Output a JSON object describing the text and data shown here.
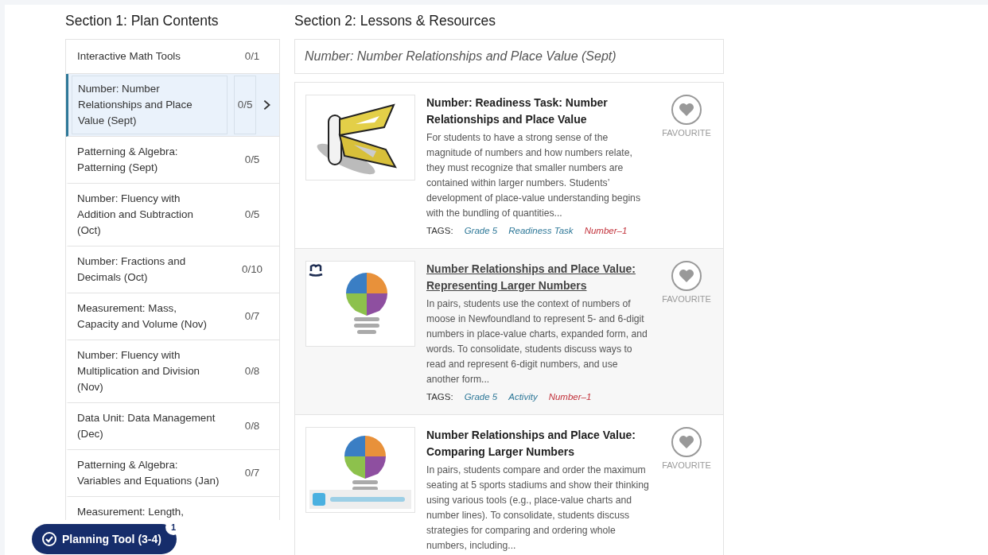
{
  "section1": {
    "title": "Section 1: Plan Contents",
    "items": [
      {
        "label": "Interactive Math Tools",
        "count": "0/1",
        "selected": false
      },
      {
        "label": "Number: Number Relationships and Place Value (Sept)",
        "count": "0/5",
        "selected": true
      },
      {
        "label": "Patterning & Algebra: Patterning (Sept)",
        "count": "0/5",
        "selected": false
      },
      {
        "label": "Number: Fluency with Addition and Subtraction (Oct)",
        "count": "0/5",
        "selected": false
      },
      {
        "label": "Number: Fractions and Decimals (Oct)",
        "count": "0/10",
        "selected": false
      },
      {
        "label": "Measurement: Mass, Capacity and Volume (Nov)",
        "count": "0/7",
        "selected": false
      },
      {
        "label": "Number: Fluency with Multiplication and Division (Nov)",
        "count": "0/8",
        "selected": false
      },
      {
        "label": "Data Unit: Data Management (Dec)",
        "count": "0/8",
        "selected": false
      },
      {
        "label": "Patterning & Algebra: Variables and Equations (Jan)",
        "count": "0/7",
        "selected": false
      },
      {
        "label": "Measurement: Length,",
        "selected": false
      }
    ]
  },
  "section2": {
    "title": "Section 2: Lessons & Resources",
    "unit_title": "Number: Number Relationships and Place Value (Sept)",
    "resources": [
      {
        "title": "Number: Readiness Task: Number Relationships and Place Value",
        "hovered": false,
        "description": "For students to have a strong sense of the magnitude of numbers and how numbers relate, they must recognize that smaller numbers are contained within larger numbers. Students’ development of place-value understanding begins with the bundling of quantities...",
        "tags_label": "TAGS:",
        "tags": [
          {
            "label": "Grade 5",
            "color": "#2e7898"
          },
          {
            "label": "Readiness Task",
            "color": "#2e7898"
          },
          {
            "label": "Number–1",
            "color": "#c2313a"
          }
        ],
        "favourite": "FAVOURITE"
      },
      {
        "title": "Number Relationships and Place Value: Representing Larger Numbers",
        "hovered": true,
        "description": "In pairs, students use the context of numbers of moose in Newfoundland to represent 5- and 6-digit numbers in place-value charts, expanded form, and words. To consolidate, students discuss ways to read and represent 6-digit numbers, and use another form...",
        "tags_label": "TAGS:",
        "tags": [
          {
            "label": "Grade 5",
            "color": "#2e7898"
          },
          {
            "label": "Activity",
            "color": "#2e7898"
          },
          {
            "label": "Number–1",
            "color": "#c2313a"
          }
        ],
        "favourite": "FAVOURITE"
      },
      {
        "title": "Number Relationships and Place Value: Comparing Larger Numbers",
        "hovered": false,
        "description": "In pairs, students compare and order the maximum seating at 5 sports stadiums and show their thinking using various tools (e.g., place-value charts and number lines). To consolidate, students discuss strategies for comparing and ordering whole numbers, including...",
        "favourite": "FAVOURITE"
      }
    ]
  },
  "planning_button": {
    "label": "Planning Tool (3-4)",
    "badge": "1"
  }
}
